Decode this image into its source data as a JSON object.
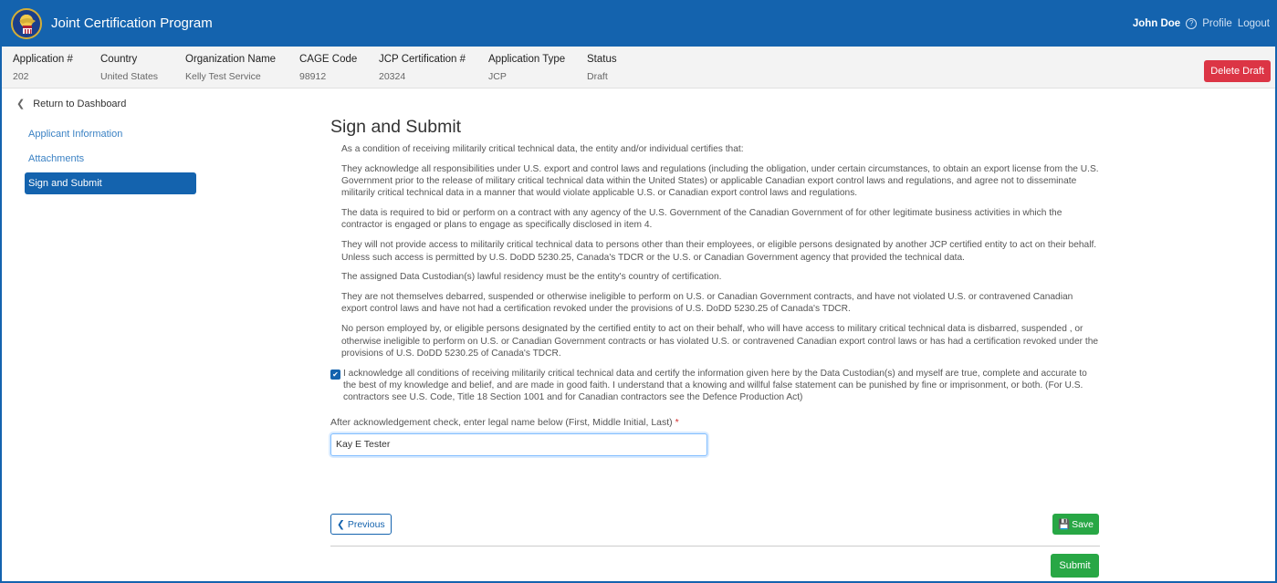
{
  "header": {
    "app_title": "Joint Certification Program",
    "user_name": "John Doe",
    "profile_label": "Profile",
    "logout_label": "Logout",
    "brand_color": "#1463ae"
  },
  "info_bar": {
    "columns": [
      {
        "label": "Application #",
        "value": "202"
      },
      {
        "label": "Country",
        "value": "United States"
      },
      {
        "label": "Organization Name",
        "value": "Kelly Test Service"
      },
      {
        "label": "CAGE Code",
        "value": "98912"
      },
      {
        "label": "JCP Certification #",
        "value": "20324"
      },
      {
        "label": "Application Type",
        "value": "JCP"
      },
      {
        "label": "Status",
        "value": "Draft"
      }
    ],
    "delete_label": "Delete Draft"
  },
  "sidebar": {
    "return_label": "Return to Dashboard",
    "items": [
      {
        "label": "Applicant Information",
        "active": false
      },
      {
        "label": "Attachments",
        "active": false
      },
      {
        "label": "Sign and Submit",
        "active": true
      }
    ]
  },
  "main": {
    "title": "Sign and Submit",
    "paragraphs": [
      "As a condition of receiving militarily critical technical data, the entity and/or individual certifies that:",
      "They acknowledge all responsibilities under U.S. export and control laws and regulations (including the obligation, under certain circumstances, to obtain an export license from the U.S. Government prior to the release of military critical technical data within the United States) or applicable Canadian export control laws and regulations, and agree not to disseminate militarily critical technical data in a manner that would violate applicable U.S. or Canadian export control laws and regulations.",
      "The data is required to bid or perform on a contract with any agency of the U.S. Government of the Canadian Government of for other legitimate business activities in which the contractor is engaged or plans to engage as specifically disclosed in item 4.",
      "They will not provide access to militarily critical technical data to persons other than their employees, or eligible persons designated by another JCP certified entity to act on their behalf. Unless such access is permitted by U.S. DoDD 5230.25, Canada's TDCR or the U.S. or Canadian Government agency that provided the technical data.",
      "The assigned Data Custodian(s) lawful residency must be the entity's country of certification.",
      "They are not themselves debarred, suspended or otherwise ineligible to perform on U.S. or Canadian Government contracts, and have not violated U.S. or contravened Canadian export control laws and have not had a certification revoked under the provisions of U.S. DoDD 5230.25 of Canada's TDCR.",
      "No person employed by, or eligible persons designated by the certified entity to act on their behalf, who will have access to military critical technical data is disbarred, suspended , or otherwise ineligible to perform on U.S. or Canadian Government contracts or has violated U.S. or contravened Canadian export control laws or has had a certification revoked under the provisions of U.S. DoDD 5230.25 of Canada's TDCR."
    ],
    "acknowledge_checked": true,
    "acknowledge_text": "I acknowledge all conditions of receiving militarily critical technical data and certify the information given here by the Data Custodian(s) and myself are true, complete and accurate to the best of my knowledge and belief, and are made in good faith. I understand that a knowing and willful false statement can be punished by fine or imprisonment, or both. (For U.S. contractors see U.S. Code, Title 18 Section 1001 and for Canadian contractors see the Defence Production Act)",
    "legal_name_label": "After acknowledgement check, enter legal name below (First, Middle Initial, Last)",
    "legal_name_required_mark": "*",
    "legal_name_value": "Kay E Tester",
    "previous_label": "Previous",
    "save_label": "Save",
    "submit_label": "Submit"
  }
}
